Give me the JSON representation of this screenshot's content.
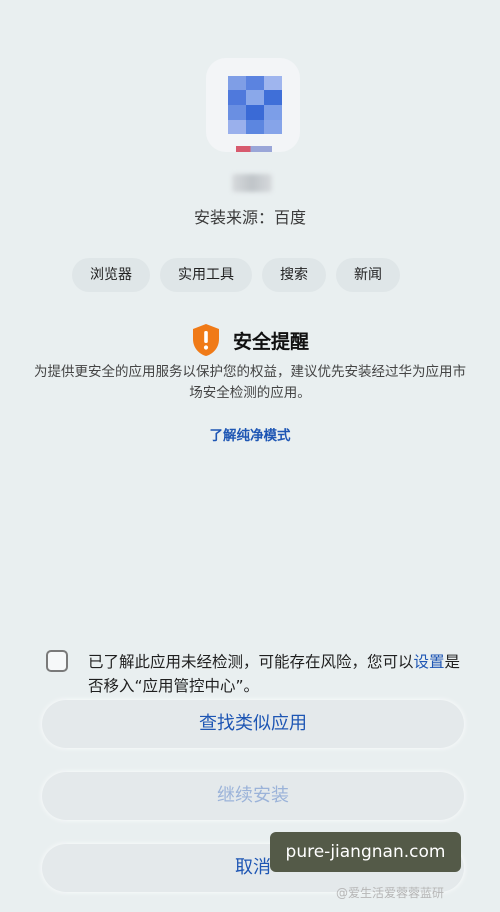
{
  "app": {
    "icon_name": "app-icon-pixelated",
    "source_label": "安装来源：百度"
  },
  "tags": [
    "浏览器",
    "实用工具",
    "搜索",
    "新闻"
  ],
  "warning": {
    "icon": "shield-alert-icon",
    "title": "安全提醒",
    "description": "为提供更安全的应用服务以保护您的权益，建议优先安装经过华为应用市场安全检测的应用。",
    "link": "了解纯净模式"
  },
  "consent": {
    "checked": false,
    "text_before": "已了解此应用未经检测，可能存在风险，您可以",
    "settings_link": "设置",
    "text_after": "是否移入“应用管控中心”。"
  },
  "buttons": {
    "find_similar": "查找类似应用",
    "continue_install": "继续安装",
    "cancel": "取消"
  },
  "watermark": {
    "badge": "pure-jiangnan.com",
    "caption": "@爱生活爱蓉蓉蓝研"
  },
  "colors": {
    "background": "#e9eff0",
    "accent_blue": "#1e56b4",
    "disabled_blue": "#9bb3d9",
    "warning_orange": "#f07a17"
  }
}
